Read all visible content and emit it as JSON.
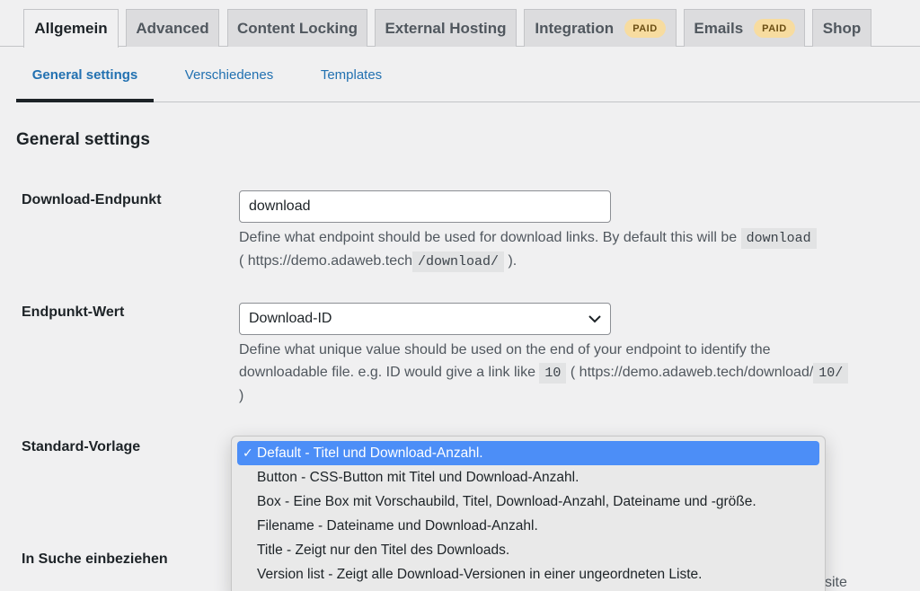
{
  "tabs": [
    {
      "label": "Allgemein",
      "active": true
    },
    {
      "label": "Advanced"
    },
    {
      "label": "Content Locking"
    },
    {
      "label": "External Hosting"
    },
    {
      "label": "Integration",
      "badge": "PAID"
    },
    {
      "label": "Emails",
      "badge": "PAID"
    },
    {
      "label": "Shop"
    }
  ],
  "subtabs": [
    {
      "label": "General settings",
      "active": true
    },
    {
      "label": "Verschiedenes"
    },
    {
      "label": "Templates"
    }
  ],
  "section_title": "General settings",
  "fields": {
    "endpoint": {
      "label": "Download-Endpunkt",
      "value": "download",
      "desc_part1": "Define what endpoint should be used for download links. By default this will be",
      "desc_code1": "download",
      "desc_part2": "( https://demo.adaweb.tech",
      "desc_code2": "/download/",
      "desc_part3": ")."
    },
    "endpoint_value": {
      "label": "Endpunkt-Wert",
      "selected": "Download-ID",
      "desc_part1": "Define what unique value should be used on the end of your endpoint to identify the downloadable file. e.g. ID would give a link like",
      "desc_code1": "10",
      "desc_part2": "( https://demo.adaweb.tech/download/",
      "desc_code2": "10/",
      "desc_part3": ")"
    },
    "template": {
      "label": "Standard-Vorlage",
      "options": [
        "Default - Titel und Download-Anzahl.",
        "Button - CSS-Button mit Titel und Download-Anzahl.",
        "Box - Eine Box mit Vorschaubild, Titel, Download-Anzahl, Dateiname und -größe.",
        "Filename - Dateiname und Download-Anzahl.",
        "Title - Zeigt nur den Titel des Downloads.",
        "Version list - Zeigt alle Download-Versionen in einer ungeordneten Liste."
      ],
      "selected_index": 0
    },
    "search": {
      "label": "In Suche einbeziehen",
      "desc_peek": "site"
    }
  },
  "colors": {
    "link": "#2271b1",
    "highlight": "#4c8ef7",
    "paid_badge": "#f7dca0"
  }
}
